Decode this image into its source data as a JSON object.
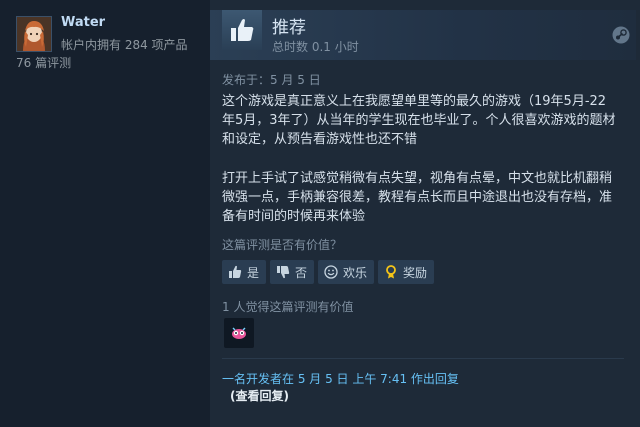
{
  "author": {
    "name": "Water",
    "products_owned": "帐户内拥有 284 项产品",
    "review_count": "76 篇评测"
  },
  "review": {
    "verdict": "推荐",
    "hours": "总时数 0.1 小时",
    "posted": "发布于：5 月 5 日",
    "paragraphs": [
      "这个游戏是真正意义上在我愿望单里等的最久的游戏（19年5月-22年5月，3年了）从当年的学生现在也毕业了。个人很喜欢游戏的题材和设定，从预告看游戏性也还不错",
      "打开上手试了试感觉稍微有点失望，视角有点晕，中文也就比机翻稍微强一点，手柄兼容很差，教程有点长而且中途退出也没有存档，准备有时间的时候再来体验"
    ]
  },
  "feedback": {
    "question": "这篇评测是否有价值？",
    "yes": "是",
    "no": "否",
    "funny": "欢乐",
    "award": "奖励",
    "helpful_count": "1 人觉得这篇评测有价值"
  },
  "developer": {
    "reply_note": "一名开发者在 5 月 5 日 上午 7:41 作出回复",
    "view_reply": "(查看回复)"
  },
  "colors": {
    "background": "#1b2838",
    "accent_link": "#66c0f4",
    "author_name": "#c1dbf4"
  }
}
